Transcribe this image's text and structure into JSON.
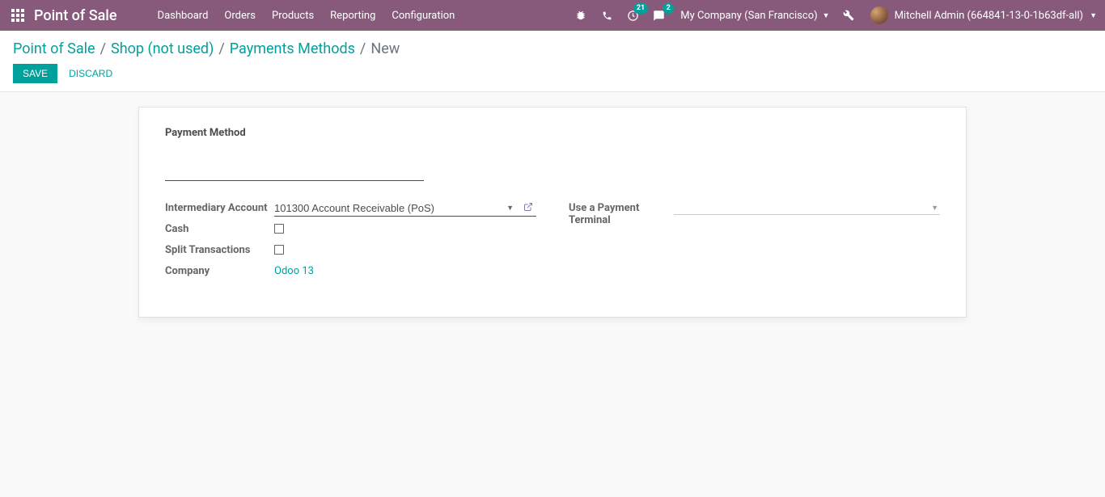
{
  "navbar": {
    "brand": "Point of Sale",
    "menu": [
      "Dashboard",
      "Orders",
      "Products",
      "Reporting",
      "Configuration"
    ],
    "activity_badge": "21",
    "message_badge": "2",
    "company": "My Company (San Francisco)",
    "user": "Mitchell Admin (664841-13-0-1b63df-all)"
  },
  "breadcrumb": {
    "items": [
      "Point of Sale",
      "Shop (not used)",
      "Payments Methods"
    ],
    "current": "New"
  },
  "actions": {
    "save": "Save",
    "discard": "Discard"
  },
  "form": {
    "title_label": "Payment Method",
    "name_value": "",
    "fields": {
      "intermediary_account": {
        "label": "Intermediary Account",
        "value": "101300 Account Receivable (PoS)"
      },
      "cash": {
        "label": "Cash",
        "checked": false
      },
      "split_transactions": {
        "label": "Split Transactions",
        "checked": false
      },
      "company": {
        "label": "Company",
        "value": "Odoo 13"
      },
      "use_terminal": {
        "label": "Use a Payment Terminal",
        "value": ""
      }
    }
  }
}
